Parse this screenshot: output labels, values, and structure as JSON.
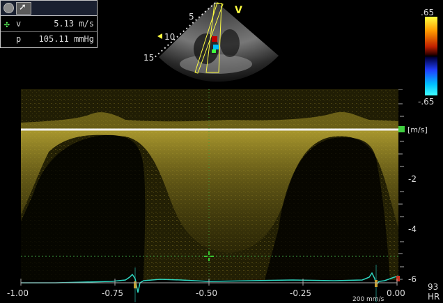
{
  "measurement": {
    "velocity_label": "v",
    "velocity_value": "5.13 m/s",
    "pressure_label": "p",
    "pressure_value": "105.11 mmHg"
  },
  "sector": {
    "depth_labels": [
      "5",
      "10",
      "15"
    ],
    "marker": "V"
  },
  "colorbar": {
    "max_label": ".65",
    "min_label": "-.65"
  },
  "velocity_axis": {
    "unit": "[m/s]",
    "labels": [
      "-2",
      "-4",
      "-6"
    ]
  },
  "time_axis": {
    "labels": [
      "-1.00",
      "-0.75",
      "-0.50",
      "-0.25",
      "0.00"
    ]
  },
  "sweep_speed": "200 mm/s",
  "heart_rate": {
    "value": "93",
    "unit": "HR"
  },
  "colors": {
    "ecg": "#2fd6c0",
    "spectrum": "#b8a830",
    "cursor": "#3fff3f"
  }
}
